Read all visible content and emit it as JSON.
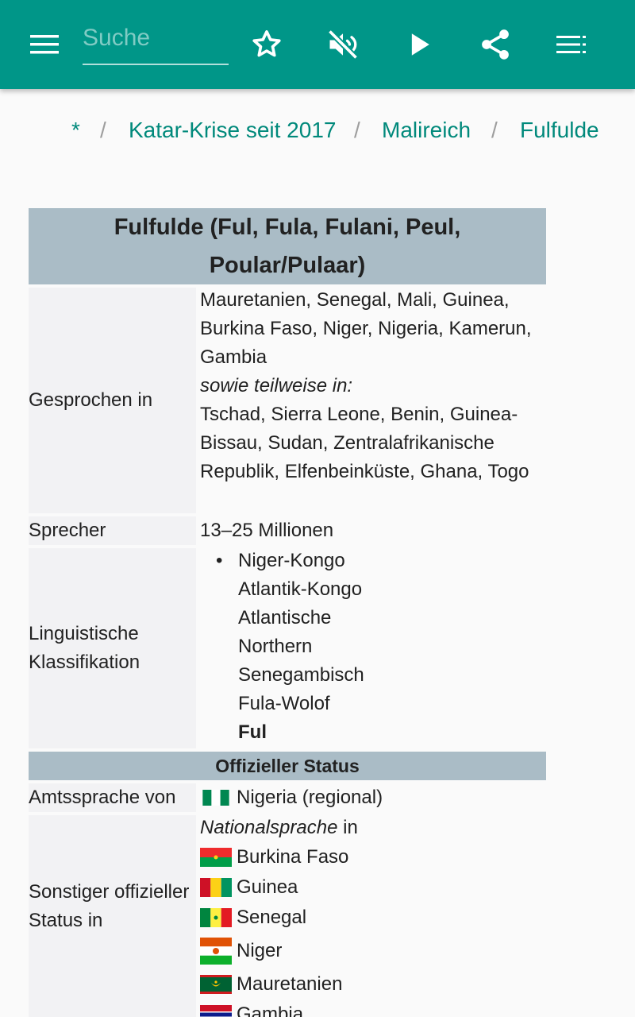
{
  "toolbar": {
    "search_placeholder": "Suche",
    "icons": [
      "menu-icon",
      "star-icon",
      "volume-off-icon",
      "play-icon",
      "share-icon",
      "list-icon"
    ]
  },
  "breadcrumb": [
    "*",
    "/",
    "Katar-Krise seit 2017",
    "/",
    "Malireich",
    "/",
    "Fulfulde"
  ],
  "infobox": {
    "title_line1": "Fulfulde (Ful, Fula, Fulani, Peul,",
    "title_line2": "Poular/Pulaar)",
    "spoken_label": "Gesprochen in",
    "spoken_lines": [
      "Mauretanien, Senegal, Mali, Guinea,",
      "Burkina Faso, Niger, Nigeria, Kamerun,",
      "Gambia"
    ],
    "spoken_partial_label": "sowie teilweise in:",
    "spoken_partial_lines": [
      "Tschad, Sierra Leone, Benin, Guinea-",
      "Bissau, Sudan, Zentralafrikanische",
      "Republik, Elfenbeinküste, Ghana, Togo"
    ],
    "speakers_label": "Sprecher",
    "speakers_value": "13–25 Millionen",
    "classification_label_1": "Linguistische",
    "classification_label_2": "Klassifikation",
    "classification": [
      "Niger-Kongo",
      "Atlantik-Kongo",
      "Atlantische",
      "Northern",
      "Senegambisch",
      "Fula-Wolof",
      "Ful"
    ],
    "status_heading": "Offizieller Status",
    "official_label": "Amtssprache von",
    "official_value": "Nigeria (regional)",
    "other_label_1": "Sonstiger offizieller",
    "other_label_2": "Status in",
    "national_italic": "Nationalsprache",
    "national_suffix": " in",
    "countries": [
      "Burkina Faso",
      "Guinea",
      "Senegal",
      "Niger",
      "Mauretanien",
      "Gambia"
    ]
  },
  "colors": {
    "toolbar": "#009688",
    "link": "#00897b",
    "header_bg": "#aabcc6",
    "label_bg": "#f2f2f4"
  }
}
